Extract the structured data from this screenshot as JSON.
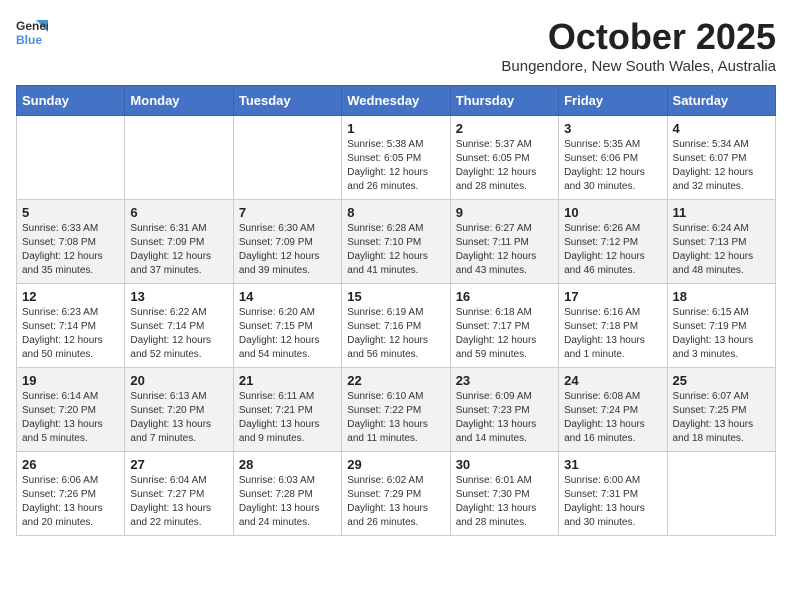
{
  "logo": {
    "general": "General",
    "blue": "Blue"
  },
  "header": {
    "month": "October 2025",
    "location": "Bungendore, New South Wales, Australia"
  },
  "weekdays": [
    "Sunday",
    "Monday",
    "Tuesday",
    "Wednesday",
    "Thursday",
    "Friday",
    "Saturday"
  ],
  "weeks": [
    [
      {
        "day": "",
        "info": ""
      },
      {
        "day": "",
        "info": ""
      },
      {
        "day": "",
        "info": ""
      },
      {
        "day": "1",
        "info": "Sunrise: 5:38 AM\nSunset: 6:05 PM\nDaylight: 12 hours\nand 26 minutes."
      },
      {
        "day": "2",
        "info": "Sunrise: 5:37 AM\nSunset: 6:05 PM\nDaylight: 12 hours\nand 28 minutes."
      },
      {
        "day": "3",
        "info": "Sunrise: 5:35 AM\nSunset: 6:06 PM\nDaylight: 12 hours\nand 30 minutes."
      },
      {
        "day": "4",
        "info": "Sunrise: 5:34 AM\nSunset: 6:07 PM\nDaylight: 12 hours\nand 32 minutes."
      }
    ],
    [
      {
        "day": "5",
        "info": "Sunrise: 6:33 AM\nSunset: 7:08 PM\nDaylight: 12 hours\nand 35 minutes."
      },
      {
        "day": "6",
        "info": "Sunrise: 6:31 AM\nSunset: 7:09 PM\nDaylight: 12 hours\nand 37 minutes."
      },
      {
        "day": "7",
        "info": "Sunrise: 6:30 AM\nSunset: 7:09 PM\nDaylight: 12 hours\nand 39 minutes."
      },
      {
        "day": "8",
        "info": "Sunrise: 6:28 AM\nSunset: 7:10 PM\nDaylight: 12 hours\nand 41 minutes."
      },
      {
        "day": "9",
        "info": "Sunrise: 6:27 AM\nSunset: 7:11 PM\nDaylight: 12 hours\nand 43 minutes."
      },
      {
        "day": "10",
        "info": "Sunrise: 6:26 AM\nSunset: 7:12 PM\nDaylight: 12 hours\nand 46 minutes."
      },
      {
        "day": "11",
        "info": "Sunrise: 6:24 AM\nSunset: 7:13 PM\nDaylight: 12 hours\nand 48 minutes."
      }
    ],
    [
      {
        "day": "12",
        "info": "Sunrise: 6:23 AM\nSunset: 7:14 PM\nDaylight: 12 hours\nand 50 minutes."
      },
      {
        "day": "13",
        "info": "Sunrise: 6:22 AM\nSunset: 7:14 PM\nDaylight: 12 hours\nand 52 minutes."
      },
      {
        "day": "14",
        "info": "Sunrise: 6:20 AM\nSunset: 7:15 PM\nDaylight: 12 hours\nand 54 minutes."
      },
      {
        "day": "15",
        "info": "Sunrise: 6:19 AM\nSunset: 7:16 PM\nDaylight: 12 hours\nand 56 minutes."
      },
      {
        "day": "16",
        "info": "Sunrise: 6:18 AM\nSunset: 7:17 PM\nDaylight: 12 hours\nand 59 minutes."
      },
      {
        "day": "17",
        "info": "Sunrise: 6:16 AM\nSunset: 7:18 PM\nDaylight: 13 hours\nand 1 minute."
      },
      {
        "day": "18",
        "info": "Sunrise: 6:15 AM\nSunset: 7:19 PM\nDaylight: 13 hours\nand 3 minutes."
      }
    ],
    [
      {
        "day": "19",
        "info": "Sunrise: 6:14 AM\nSunset: 7:20 PM\nDaylight: 13 hours\nand 5 minutes."
      },
      {
        "day": "20",
        "info": "Sunrise: 6:13 AM\nSunset: 7:20 PM\nDaylight: 13 hours\nand 7 minutes."
      },
      {
        "day": "21",
        "info": "Sunrise: 6:11 AM\nSunset: 7:21 PM\nDaylight: 13 hours\nand 9 minutes."
      },
      {
        "day": "22",
        "info": "Sunrise: 6:10 AM\nSunset: 7:22 PM\nDaylight: 13 hours\nand 11 minutes."
      },
      {
        "day": "23",
        "info": "Sunrise: 6:09 AM\nSunset: 7:23 PM\nDaylight: 13 hours\nand 14 minutes."
      },
      {
        "day": "24",
        "info": "Sunrise: 6:08 AM\nSunset: 7:24 PM\nDaylight: 13 hours\nand 16 minutes."
      },
      {
        "day": "25",
        "info": "Sunrise: 6:07 AM\nSunset: 7:25 PM\nDaylight: 13 hours\nand 18 minutes."
      }
    ],
    [
      {
        "day": "26",
        "info": "Sunrise: 6:06 AM\nSunset: 7:26 PM\nDaylight: 13 hours\nand 20 minutes."
      },
      {
        "day": "27",
        "info": "Sunrise: 6:04 AM\nSunset: 7:27 PM\nDaylight: 13 hours\nand 22 minutes."
      },
      {
        "day": "28",
        "info": "Sunrise: 6:03 AM\nSunset: 7:28 PM\nDaylight: 13 hours\nand 24 minutes."
      },
      {
        "day": "29",
        "info": "Sunrise: 6:02 AM\nSunset: 7:29 PM\nDaylight: 13 hours\nand 26 minutes."
      },
      {
        "day": "30",
        "info": "Sunrise: 6:01 AM\nSunset: 7:30 PM\nDaylight: 13 hours\nand 28 minutes."
      },
      {
        "day": "31",
        "info": "Sunrise: 6:00 AM\nSunset: 7:31 PM\nDaylight: 13 hours\nand 30 minutes."
      },
      {
        "day": "",
        "info": ""
      }
    ]
  ]
}
